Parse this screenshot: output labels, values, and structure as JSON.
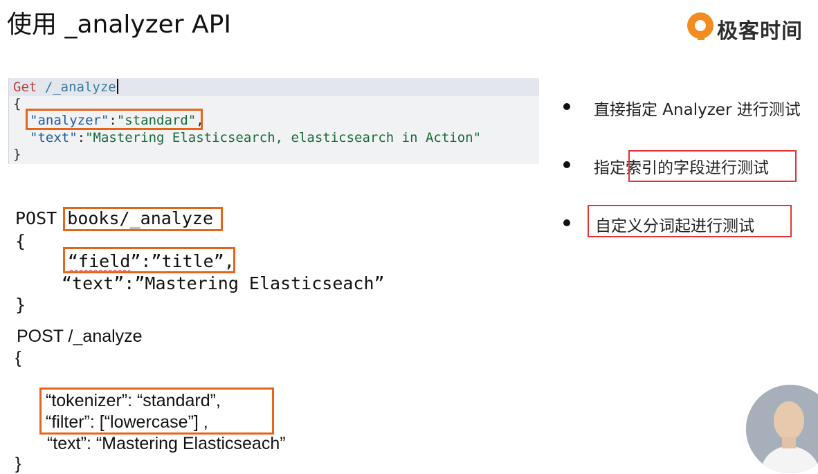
{
  "title": "使用 _analyzer API",
  "logo": {
    "text": "极客时间"
  },
  "console": {
    "method": "Get",
    "path": "/_analyze",
    "open_brace": "{",
    "close_brace": "}",
    "analyzer_key": "\"analyzer\"",
    "analyzer_colon": ":",
    "analyzer_value": "\"standard\"",
    "comma": ",",
    "text_key": "\"text\"",
    "text_colon": ":",
    "text_value": "\"Mastering Elasticsearch, elasticsearch in Action\""
  },
  "example2": {
    "method": "POST",
    "path": "books/_analyze",
    "open_brace": "{",
    "close_brace": "}",
    "field_key": "“field",
    "field_colon_value": "”:”title”",
    "field_comma": ",",
    "text_line": "“text”:”Mastering Elasticseach”"
  },
  "example3": {
    "line_post": "POST /_analyze",
    "open_brace": "{",
    "tokenizer_line": "“tokenizer”: “standard”,",
    "filter_line": "“filter”: [“lowercase”] ,",
    "text_line": "“text”: “Mastering Elasticseach”",
    "close_brace": "}"
  },
  "bullets": [
    {
      "text": "直接指定 Analyzer 进行测试"
    },
    {
      "prefix": "指定",
      "highlight": "索引的字段进行测试"
    },
    {
      "highlight": "自定义分词起进行测试"
    }
  ],
  "colors": {
    "accent_orange": "#e5661b",
    "accent_red": "#e23232",
    "logo_orange": "#f38b1e"
  },
  "icons": {
    "logo": "geektime-logo-icon",
    "avatar": "presenter-avatar"
  }
}
